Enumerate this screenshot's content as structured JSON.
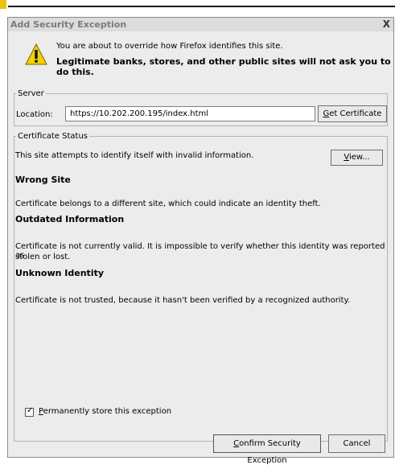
{
  "dialog": {
    "title": "Add Security Exception",
    "close_glyph": "X",
    "warning_icon": "warning-triangle-icon",
    "intro_text": "You are about to override how Firefox identifies this site.",
    "intro_bold": "Legitimate banks, stores, and other public sites will not ask you to do this."
  },
  "server": {
    "legend": "Server",
    "location_label": "Location:",
    "location_value": "https://10.202.200.195/index.html",
    "get_certificate": {
      "underline": "G",
      "rest": "et Certificate"
    }
  },
  "status": {
    "legend": "Certificate Status",
    "summary": "This site attempts to identify itself with invalid information.",
    "view_button": {
      "underline": "V",
      "rest": "iew..."
    },
    "sections": [
      {
        "heading": "Wrong Site",
        "text": "Certificate belongs to a different site, which could indicate an identity theft."
      },
      {
        "heading": "Outdated Information",
        "text_line1": "Certificate is not currently valid. It is impossible to verify whether this identity was reported as",
        "text_line2": "stolen or lost."
      },
      {
        "heading": "Unknown Identity",
        "text": "Certificate is not trusted, because it hasn't been verified by a recognized authority."
      }
    ]
  },
  "permanent": {
    "checked": true,
    "underline": "P",
    "rest": "ermanently store this exception"
  },
  "buttons": {
    "confirm": {
      "underline": "C",
      "rest": "onfirm Security Exception"
    },
    "cancel": "Cancel"
  },
  "colors": {
    "dialog_bg": "#ececec",
    "titlebar_text": "#7a7a7a",
    "warning_yellow": "#f2d200"
  }
}
